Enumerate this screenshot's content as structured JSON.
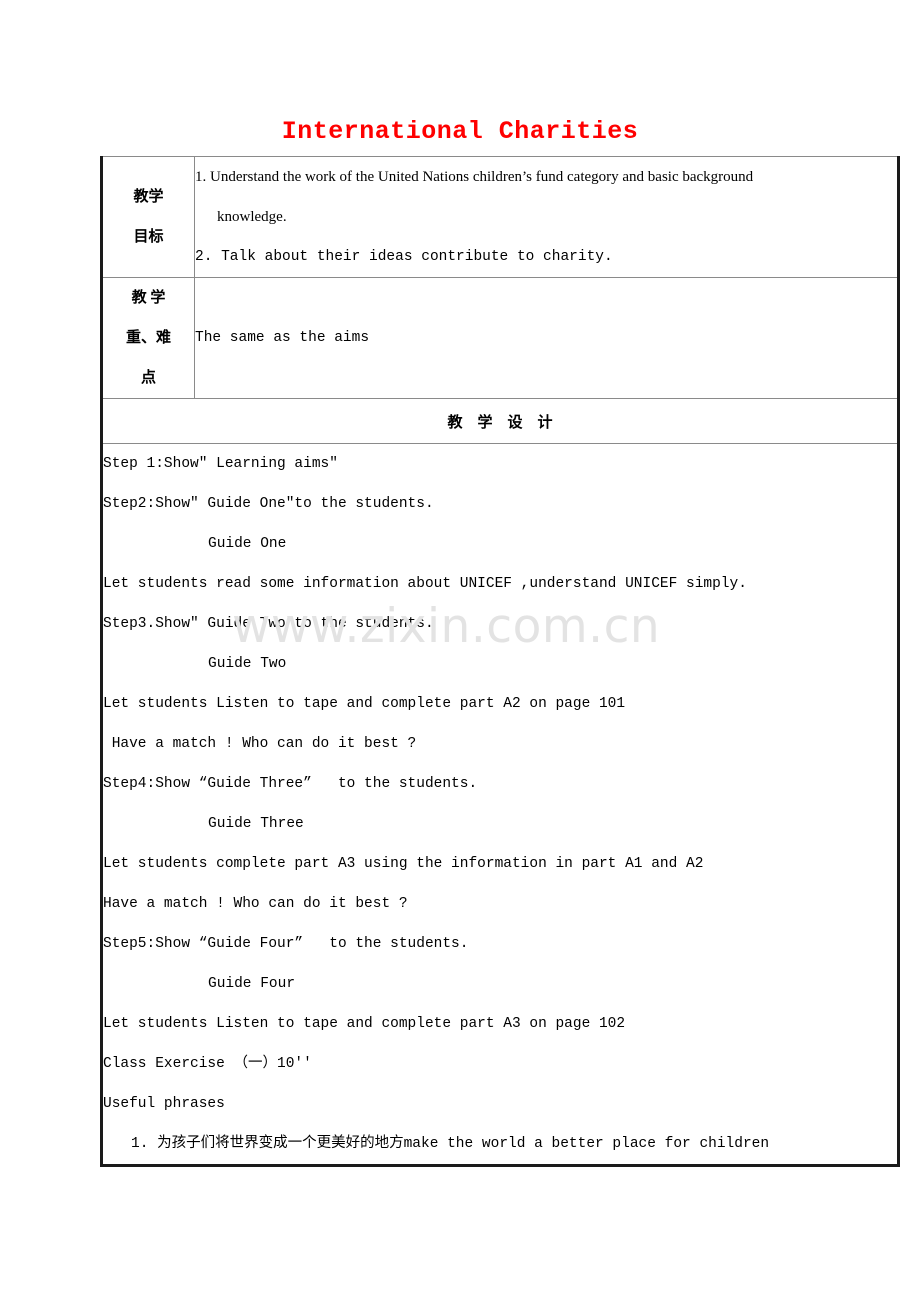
{
  "title": "International Charities",
  "title_color": "#ff0000",
  "watermark": "www.zixin.com.cn",
  "table": {
    "aims_row": {
      "label_line1": "教学",
      "label_line2": "目标",
      "item1": "1. Understand the work of the United Nations children’s fund category and basic background",
      "item1_cont": "knowledge.",
      "item2": "2. Talk about their ideas contribute to charity."
    },
    "focus_row": {
      "label_line1": "教 学",
      "label_line2": "重、难",
      "label_line3": "点",
      "content": "The same as the aims"
    },
    "section_header": "教    学    设    计",
    "body": {
      "lines": [
        {
          "text": "Step 1:Show″ Learning aims″",
          "indent": 0
        },
        {
          "text": "Step2:Show″ Guide One″to the students.",
          "indent": 0
        },
        {
          "text": "Guide One",
          "indent": 1
        },
        {
          "text": "Let students read some information about UNICEF ,understand UNICEF simply.",
          "indent": 0
        },
        {
          "text": "Step3.Show″ Guide Two″to the students.",
          "indent": 0
        },
        {
          "text": "Guide Two",
          "indent": 1
        },
        {
          "text": "Let students Listen to tape and complete part A2 on page 101",
          "indent": 0
        },
        {
          "text": " Have a match ! Who can do it best ?",
          "indent": 0
        },
        {
          "text": "Step4:Show “Guide Three”   to the students.",
          "indent": 0
        },
        {
          "text": "Guide Three",
          "indent": 1
        },
        {
          "text": "Let students complete part A3 using the information in part A1 and A2",
          "indent": 0
        },
        {
          "text": "Have a match ! Who can do it best ?",
          "indent": 0
        },
        {
          "text": "Step5:Show “Guide Four”   to the students.",
          "indent": 0
        },
        {
          "text": "Guide Four",
          "indent": 1
        },
        {
          "text": "Let students Listen to tape and complete part A3 on page 102",
          "indent": 0
        },
        {
          "text": "Class Exercise （一）10′′",
          "indent": 0
        },
        {
          "text": "Useful phrases",
          "indent": 0
        },
        {
          "text": "1. 为孩子们将世界变成一个更美好的地方make the world a better place for children",
          "indent": 2
        }
      ]
    }
  }
}
